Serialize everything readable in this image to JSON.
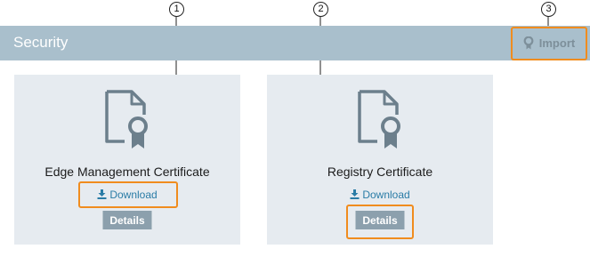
{
  "header": {
    "title": "Security",
    "import_label": "Import"
  },
  "cards": [
    {
      "title": "Edge Management Certificate",
      "download_label": "Download",
      "details_label": "Details"
    },
    {
      "title": "Registry Certificate",
      "download_label": "Download",
      "details_label": "Details"
    }
  ],
  "callouts": [
    "1",
    "2",
    "3"
  ],
  "colors": {
    "header_bg": "#a9bfcc",
    "card_bg": "#e6ebf0",
    "link": "#2a7ca6",
    "button": "#8ca0ad",
    "highlight": "#f08c1e"
  }
}
